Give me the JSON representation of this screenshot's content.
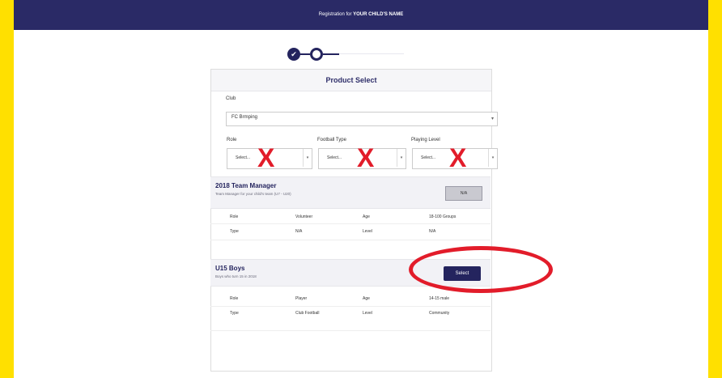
{
  "header": {
    "prefix": "Registration for",
    "child_name": "YOUR CHILD'S NAME"
  },
  "stepper": {
    "current_step": 2
  },
  "card": {
    "title": "Product Select",
    "club_label": "Club",
    "club_value": "FC Brmping",
    "role_label": "Role",
    "football_type_label": "Football Type",
    "playing_level_label": "Playing Level",
    "select_placeholder_1": "Select...",
    "select_placeholder_2": "Select...",
    "select_placeholder_3": "Select...",
    "x_mark": "X"
  },
  "products": [
    {
      "title": "2018 Team Manager",
      "subtitle": "Team Manager for your child's team (U7 - U20)",
      "button_label": "N/A",
      "fields": [
        {
          "k1": "Role",
          "v1": "Volunteer",
          "k2": "Age",
          "v2": "18-100 Groups"
        },
        {
          "k1": "Type",
          "v1": "N/A",
          "k2": "Level",
          "v2": "N/A"
        }
      ]
    },
    {
      "title": "U15 Boys",
      "subtitle": "Boys who turn 15 in 2018",
      "button_label": "Select",
      "fields": [
        {
          "k1": "Role",
          "v1": "Player",
          "k2": "Age",
          "v2": "14-15 male"
        },
        {
          "k1": "Type",
          "v1": "Club Football",
          "k2": "Level",
          "v2": "Community"
        }
      ]
    }
  ],
  "annotation_color": "#e21c2a",
  "brand_color": "#24245e"
}
